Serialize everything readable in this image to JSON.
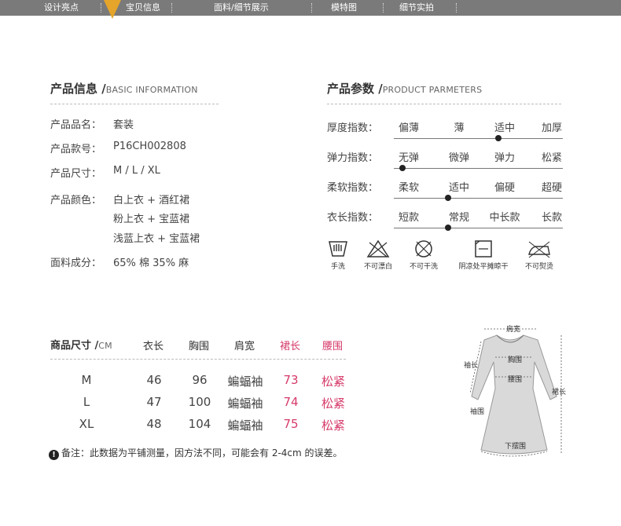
{
  "tabs": [
    "设计亮点",
    "宝贝信息",
    "面料/细节展示",
    "模特图",
    "细节实拍"
  ],
  "basic": {
    "title": "产品信息 /",
    "subtitle": "BASIC INFORMATION",
    "name_label": "产品品名：",
    "name_value": "套装",
    "sku_label": "产品款号：",
    "sku_value": "P16CH002808",
    "size_label": "产品尺寸：",
    "size_value": "M / L / XL",
    "color_label": "产品颜色：",
    "colors": [
      "白上衣 + 酒红裙",
      "粉上衣 + 宝蓝裙",
      "浅蓝上衣 + 宝蓝裙"
    ],
    "fabric_label": "面料成分：",
    "fabric_value": "65% 棉 35% 麻"
  },
  "params": {
    "title": "产品参数 /",
    "subtitle": "PRODUCT PARMETERS",
    "rows": [
      {
        "label": "厚度指数：",
        "options": [
          "偏薄",
          "薄",
          "适中",
          "加厚"
        ],
        "selected": 2
      },
      {
        "label": "弹力指数：",
        "options": [
          "无弹",
          "微弹",
          "弹力",
          "松紧"
        ],
        "selected": 0
      },
      {
        "label": "柔软指数：",
        "options": [
          "柔软",
          "适中",
          "偏硬",
          "超硬"
        ],
        "selected": 1
      },
      {
        "label": "衣长指数：",
        "options": [
          "短款",
          "常规",
          "中长款",
          "长款"
        ],
        "selected": 1
      }
    ]
  },
  "care": [
    "手洗",
    "不可漂白",
    "不可干洗",
    "阴凉处平摊晾干",
    "不可熨烫"
  ],
  "size_table": {
    "title": "商品尺寸 /",
    "unit": "CM",
    "headers": [
      "衣长",
      "胸围",
      "肩宽",
      "裙长",
      "腰围"
    ],
    "rows": [
      [
        "M",
        "46",
        "96",
        "蝙蝠袖",
        "73",
        "松紧"
      ],
      [
        "L",
        "47",
        "100",
        "蝙蝠袖",
        "74",
        "松紧"
      ],
      [
        "XL",
        "48",
        "104",
        "蝙蝠袖",
        "75",
        "松紧"
      ]
    ],
    "note": "备注：此数据为平铺测量，因方法不同，可能会有 2-4cm 的误差。"
  },
  "diagram": {
    "labels": [
      "肩宽",
      "袖长",
      "胸围",
      "腰围",
      "袖围",
      "裙长",
      "下摆围"
    ]
  },
  "colors": {
    "tabbar": "#7a7a7a",
    "marker": "#e5a52a",
    "accent": "#d63a6a"
  }
}
